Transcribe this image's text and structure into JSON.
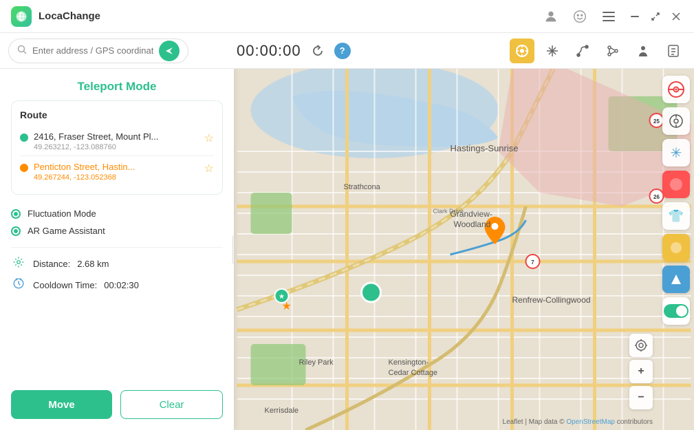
{
  "app": {
    "title": "LocaChange",
    "logo_icon": "🌐"
  },
  "title_bar": {
    "avatar_btn": "👤",
    "emoji_btn": "😊",
    "menu_btn": "☰",
    "minimize_btn": "−",
    "maximize_btn": "⤢",
    "close_btn": "✕"
  },
  "toolbar": {
    "search_placeholder": "Enter address / GPS coordinates",
    "send_icon": "➤",
    "timer": "00:00:00",
    "refresh_icon": "↻",
    "help_icon": "?",
    "teleport_icon": "⊕",
    "move_icon": "⊕",
    "route_icon": "↝",
    "branch_icon": "⑂",
    "person_icon": "👤",
    "history_icon": "⌚"
  },
  "panel": {
    "title": "Teleport Mode",
    "route_label": "Route",
    "route_from": {
      "name": "2416, Fraser Street, Mount Pl...",
      "coords": "49.263212, -123.088760",
      "type": "green"
    },
    "route_to": {
      "name": "Penticton Street, Hastin...",
      "coords": "49.267244, -123.052368",
      "type": "orange"
    },
    "options": [
      {
        "label": "Fluctuation Mode"
      },
      {
        "label": "AR Game Assistant"
      }
    ],
    "distance_label": "Distance:",
    "distance_value": "2.68 km",
    "cooldown_label": "Cooldown Time:",
    "cooldown_value": "00:02:30",
    "move_btn": "Move",
    "clear_btn": "Clear"
  },
  "map": {
    "attribution": "Leaflet | Map data © OpenStreetMap contributors"
  },
  "right_sidebar": {
    "pokeball_btn": "⚫",
    "compass_btn": "◎",
    "star_btn": "✳",
    "red_btn": "🔴",
    "shirt_btn": "👕",
    "potion_btn": "🟡",
    "arrow_btn": "➤",
    "toggle_label": "toggle"
  }
}
